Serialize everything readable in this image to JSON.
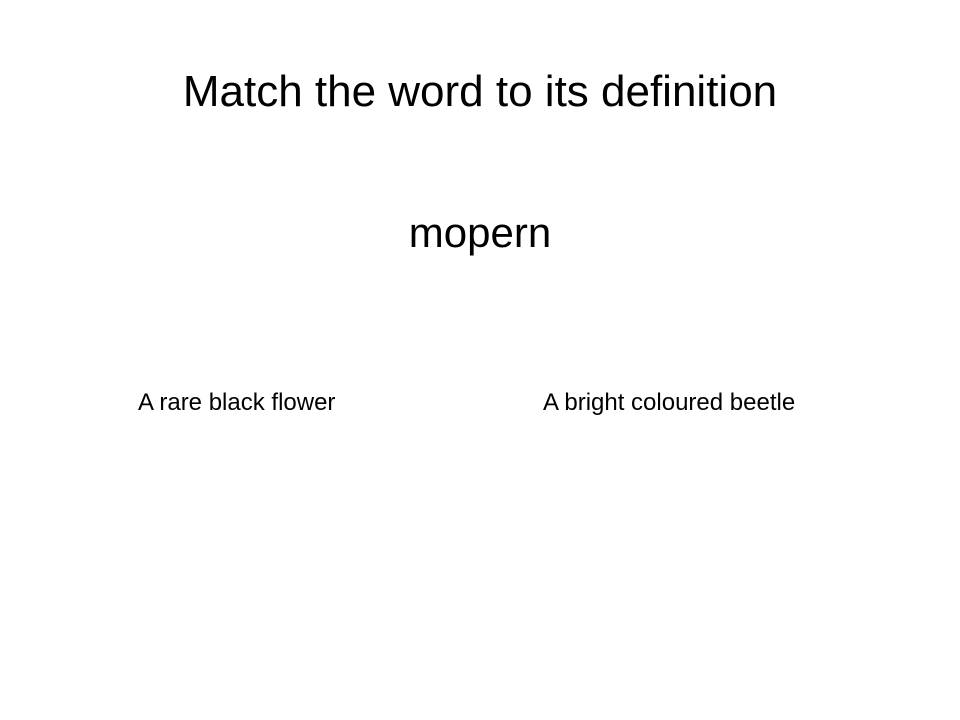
{
  "slide": {
    "title": "Match the word to its definition",
    "word": "mopern",
    "options": [
      {
        "label": "A rare black flower"
      },
      {
        "label": "A bright coloured beetle"
      }
    ]
  }
}
